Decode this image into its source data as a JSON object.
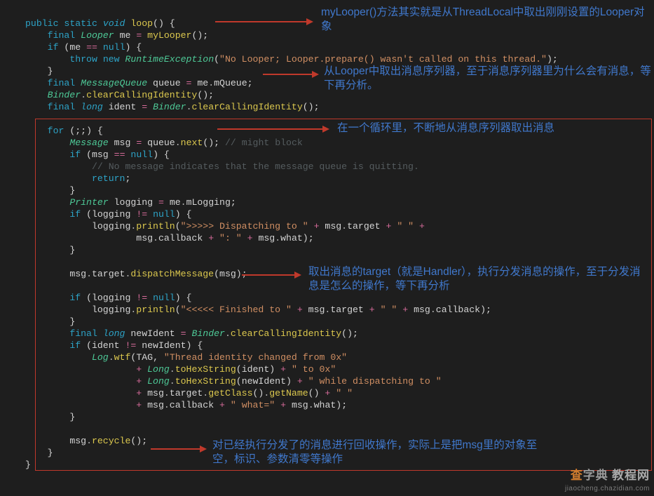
{
  "code": {
    "l1": {
      "kw_public": "public",
      "kw_static": "static",
      "kw_void": "void",
      "name": "loop",
      "p": "()",
      "b": "{"
    },
    "l2": {
      "kw": "final",
      "type": "Looper",
      "var": "me",
      "eq": "=",
      "call": "myLooper",
      "p": "();"
    },
    "l3": {
      "kw": "if",
      "p1": "(",
      "v": "me",
      "op": "==",
      "null": "null",
      "p2": ") {"
    },
    "l4": {
      "throw": "throw",
      "new": "new",
      "type": "RuntimeException",
      "p1": "(",
      "str": "\"No Looper; Looper.prepare() wasn't called on this thread.\"",
      "p2": ");"
    },
    "l5": {
      "b": "}"
    },
    "l6": {
      "kw": "final",
      "type": "MessageQueue",
      "var": "queue",
      "eq": "=",
      "me": "me",
      "d": ".",
      "f": "mQueue",
      "p": ";"
    },
    "l7": {
      "type": "Binder",
      "d": ".",
      "m": "clearCallingIdentity",
      "p": "();"
    },
    "l8": {
      "kw": "final",
      "long": "long",
      "var": "ident",
      "eq": "=",
      "type": "Binder",
      "d": ".",
      "m": "clearCallingIdentity",
      "p": "();"
    },
    "l10": {
      "kw": "for",
      "p": "(;;) {"
    },
    "l11": {
      "type": "Message",
      "var": "msg",
      "eq": "=",
      "q": "queue",
      "d": ".",
      "m": "next",
      "p": "();",
      "c": " // might block"
    },
    "l12": {
      "kw": "if",
      "p1": "(",
      "v": "msg",
      "op": "==",
      "null": "null",
      "p2": ") {",
      "extra": " "
    },
    "l13": {
      "c": "// No message indicates that the message queue is quitting."
    },
    "l14": {
      "kw": "return",
      "p": ";"
    },
    "l15": {
      "b": "}"
    },
    "l16": {
      "type": "Printer",
      "var": "logging",
      "eq": "=",
      "me": "me",
      "d": ".",
      "f": "mLogging",
      "p": ";"
    },
    "l17": {
      "kw": "if",
      "p1": "(",
      "v": "logging",
      "op": "!=",
      "null": "null",
      "p2": ") {"
    },
    "l18a": {
      "v": "logging",
      "d": ".",
      "m": "println",
      "p1": "(",
      "s": "\">>>>> Dispatching to \"",
      "plus": "+",
      "msg": "msg",
      "d2": ".",
      "tgt": "target",
      "plus2": "+",
      "s2": "\" \"",
      "plus3": "+"
    },
    "l18b": {
      "msg": "msg",
      "d": ".",
      "cb": "callback",
      "plus": "+",
      "s": "\": \"",
      "plus2": "+",
      "msg2": "msg",
      "d2": ".",
      "w": "what",
      "p": ");"
    },
    "l19": {
      "b": "}"
    },
    "l21": {
      "msg": "msg",
      "d": ".",
      "tgt": "target",
      "d2": ".",
      "m": "dispatchMessage",
      "p1": "(",
      "a": "msg",
      "p2": ");"
    },
    "l23": {
      "kw": "if",
      "p1": "(",
      "v": "logging",
      "op": "!=",
      "null": "null",
      "p2": ") {"
    },
    "l24": {
      "v": "logging",
      "d": ".",
      "m": "println",
      "p1": "(",
      "s": "\"<<<<< Finished to \"",
      "plus": "+",
      "msg": "msg",
      "d2": ".",
      "tgt": "target",
      "plus2": "+",
      "s2": "\" \"",
      "plus3": "+",
      "msg2": "msg",
      "d3": ".",
      "cb": "callback",
      "p2": ");"
    },
    "l25": {
      "b": "}"
    },
    "l26": {
      "kw": "final",
      "long": "long",
      "var": "newIdent",
      "eq": "=",
      "type": "Binder",
      "d": ".",
      "m": "clearCallingIdentity",
      "p": "();"
    },
    "l27": {
      "kw": "if",
      "p1": "(",
      "v": "ident",
      "op": "!=",
      "v2": "newIdent",
      "p2": ") {"
    },
    "l28a": {
      "type": "Log",
      "d": ".",
      "m": "wtf",
      "p1": "(",
      "tag": "TAG",
      "c": ",",
      "s": "\"Thread identity changed from 0x\""
    },
    "l28b": {
      "plus": "+",
      "type": "Long",
      "d": ".",
      "m": "toHexString",
      "p1": "(",
      "a": "ident",
      "p2": ")",
      "plus2": "+",
      "s": "\" to 0x\""
    },
    "l28c": {
      "plus": "+",
      "type": "Long",
      "d": ".",
      "m": "toHexString",
      "p1": "(",
      "a": "newIdent",
      "p2": ")",
      "plus2": "+",
      "s": "\" while dispatching to \""
    },
    "l28d": {
      "plus": "+",
      "msg": "msg",
      "d": ".",
      "tgt": "target",
      "d2": ".",
      "m": "getClass",
      "p": "()",
      "d3": ".",
      "m2": "getName",
      "p2": "()",
      "plus2": "+",
      "s": "\" \""
    },
    "l28e": {
      "plus": "+",
      "msg": "msg",
      "d": ".",
      "cb": "callback",
      "plus2": "+",
      "s": "\" what=\"",
      "plus3": "+",
      "msg2": "msg",
      "d2": ".",
      "w": "what",
      "p": ");"
    },
    "l29": {
      "b": "}"
    },
    "l31": {
      "msg": "msg",
      "d": ".",
      "m": "recycle",
      "p": "();"
    },
    "l32": {
      "b": "}"
    },
    "l33": {
      "b": "}"
    }
  },
  "anno": {
    "a1": "myLooper()方法其实就是从ThreadLocal中取出刚刚设置的Looper对象",
    "a2": "从Looper中取出消息序列器，至于消息序列器里为什么会有消息，等下再分析。",
    "a3": "在一个循环里，不断地从消息序列器取出消息",
    "a4": "取出消息的target（就是Handler），执行分发消息的操作，至于分发消息是怎么的操作，等下再分析",
    "a5": "对已经执行分发了的消息进行回收操作，实际上是把msg里的对象至空，标识、参数清零等操作"
  },
  "watermark": {
    "cn_a": "查",
    "cn_b": "字典",
    "cn_c": " 教程网",
    "url": "jiaocheng.chazidian.com"
  }
}
